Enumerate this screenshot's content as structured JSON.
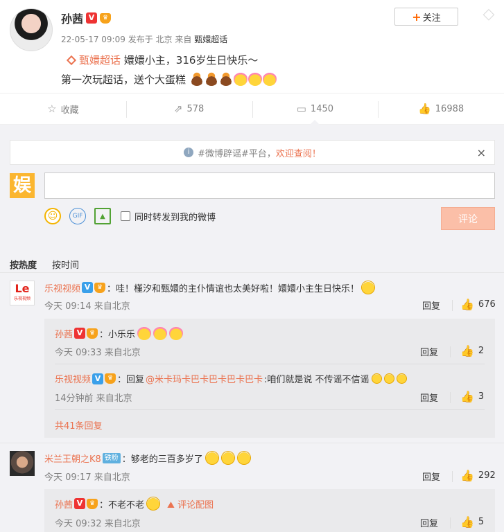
{
  "post": {
    "author": "孙茜",
    "time": "22-05-17 09:09",
    "published_label": "发布于",
    "location": "北京",
    "source_label": "来自",
    "source": "甄嬛超话",
    "follow": "关注",
    "topic": "甄嬛超话",
    "line1": "嬛嬛小主，316岁生日快乐～",
    "line2": "第一次玩超话，送个大蛋糕"
  },
  "actions": {
    "favorite": "收藏",
    "repost": "578",
    "comment": "1450",
    "like": "16988"
  },
  "notice": {
    "text": "#微博辟谣#平台，",
    "link": "欢迎查阅！",
    "close": "×"
  },
  "composer": {
    "avatar_char": "娱",
    "input_value": "",
    "sync_label": "同时转发到我的微博",
    "submit": "评论",
    "gif": "GIF"
  },
  "sort": {
    "hot": "按热度",
    "time": "按时间"
  },
  "comments": [
    {
      "user": "乐视视频",
      "text": "：哇！槿汐和甄嬛的主仆情谊也太美好啦！嬛嬛小主生日快乐！",
      "time": "今天 09:14 来自北京",
      "reply": "回复",
      "likes": "676",
      "logo": "Le",
      "logo_sub": "乐视视频"
    },
    {
      "user": "米兰王朝之K8",
      "badge": "铁粉",
      "text": "：够老的三百多岁了",
      "time": "今天 09:17 来自北京",
      "reply": "回复",
      "likes": "292"
    }
  ],
  "replies_1": [
    {
      "user": "孙茜",
      "text": "：小乐乐",
      "time": "今天 09:33 来自北京",
      "reply": "回复",
      "likes": "2"
    },
    {
      "user": "乐视视频",
      "prefix": "：回复",
      "mention": "@米卡玛卡巴卡巴卡巴卡巴卡",
      "text": ":咱们就是说 不传谣不信谣",
      "time": "14分钟前 来自北京",
      "reply": "回复",
      "likes": "3"
    }
  ],
  "more_replies": "共41条回复",
  "replies_2": [
    {
      "user": "孙茜",
      "text": "：不老不老",
      "pic_label": "评论配图",
      "time": "今天 09:32 来自北京",
      "reply": "回复",
      "likes": "5"
    }
  ],
  "icons": {
    "verified": "V",
    "crown": "♛",
    "plus": "+",
    "star": "☆",
    "repost": "⇗",
    "comment": "▭",
    "thumb": "👍",
    "info": "i"
  }
}
